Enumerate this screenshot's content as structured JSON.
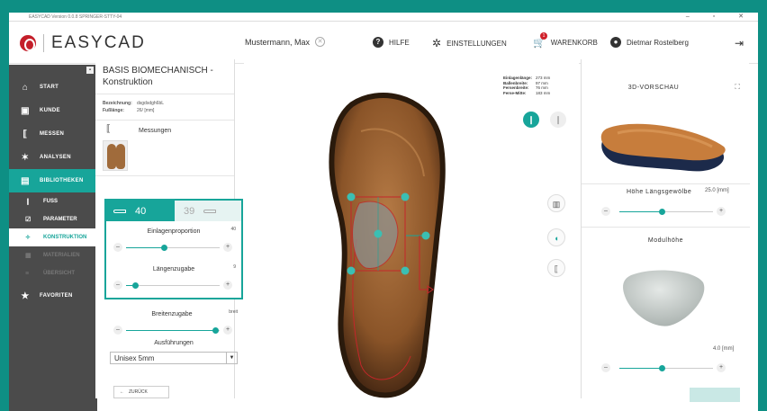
{
  "window": {
    "title": "EASYCAD Version 0.0.8 SPRINGER-STTY-04",
    "controls": "–  ▫  ✕"
  },
  "header": {
    "logo_text": "EASYCAD",
    "patient": "Mustermann, Max",
    "help": "HILFE",
    "settings": "EINSTELLUNGEN",
    "cart": "WARENKORB",
    "cart_count": "1",
    "user": "Dietmar Rostelberg"
  },
  "sidebar": {
    "items": [
      {
        "label": "START",
        "icon": "home-icon",
        "glyph": "⌂"
      },
      {
        "label": "KUNDE",
        "icon": "person-card-icon",
        "glyph": "▣"
      },
      {
        "label": "MESSEN",
        "icon": "measure-icon",
        "glyph": "⟦"
      },
      {
        "label": "ANALYSEN",
        "icon": "figure-icon",
        "glyph": "✶"
      },
      {
        "label": "BIBLIOTHEKEN",
        "icon": "library-icon",
        "glyph": "▤"
      }
    ],
    "subitems": [
      {
        "label": "FUSS",
        "glyph": "❙"
      },
      {
        "label": "PARAMETER",
        "glyph": "☑"
      },
      {
        "label": "KONSTRUKTION",
        "glyph": "✧"
      },
      {
        "label": "MATERIALIEN",
        "glyph": "▦"
      },
      {
        "label": "ÜBERSICHT",
        "glyph": "≡"
      }
    ],
    "favorites": "FAVORITEN"
  },
  "left_panel": {
    "title": "BASIS BIOMECHANISCH - Konstruktion",
    "bez_label": "Bezeichnung:",
    "bez_value": "dsgdsdgh6bL",
    "fuell_label": "Fußlänge:",
    "fuell_value": "26/ [mm]",
    "messungen": "Messungen",
    "size_active": "40",
    "size_other": "39",
    "params": [
      {
        "label": "Einlagenproportion",
        "value": "40",
        "level": 0.4
      },
      {
        "label": "Längenzugabe",
        "value": "9",
        "level": 0.1
      },
      {
        "label": "Breitenzugabe",
        "value": "breit",
        "level": 0.95
      }
    ],
    "ausfuehrungen": "Ausführungen",
    "select_value": "Unisex 5mm",
    "back": "ZURÜCK"
  },
  "center": {
    "measurements": [
      {
        "label": "Einlagenlänge:",
        "value": "273 mm"
      },
      {
        "label": "Ballenbreite:",
        "value": "97 mm"
      },
      {
        "label": "Fersenbreite:",
        "value": "76 mm"
      },
      {
        "label": "Ferse-Mitte:",
        "value": "183 mm"
      }
    ]
  },
  "right_panel": {
    "preview_title": "3D-VORSCHAU",
    "p1_label": "Höhe Längsgewölbe",
    "p1_value": "25.0 [mm]",
    "p1_level": 0.45,
    "modul_title": "Modulhöhe",
    "p2_value": "4.0 [mm]",
    "p2_level": 0.45
  },
  "colors": {
    "accent": "#17a59a",
    "brand": "#c41f2a",
    "sidebar": "#4b4b4b"
  }
}
